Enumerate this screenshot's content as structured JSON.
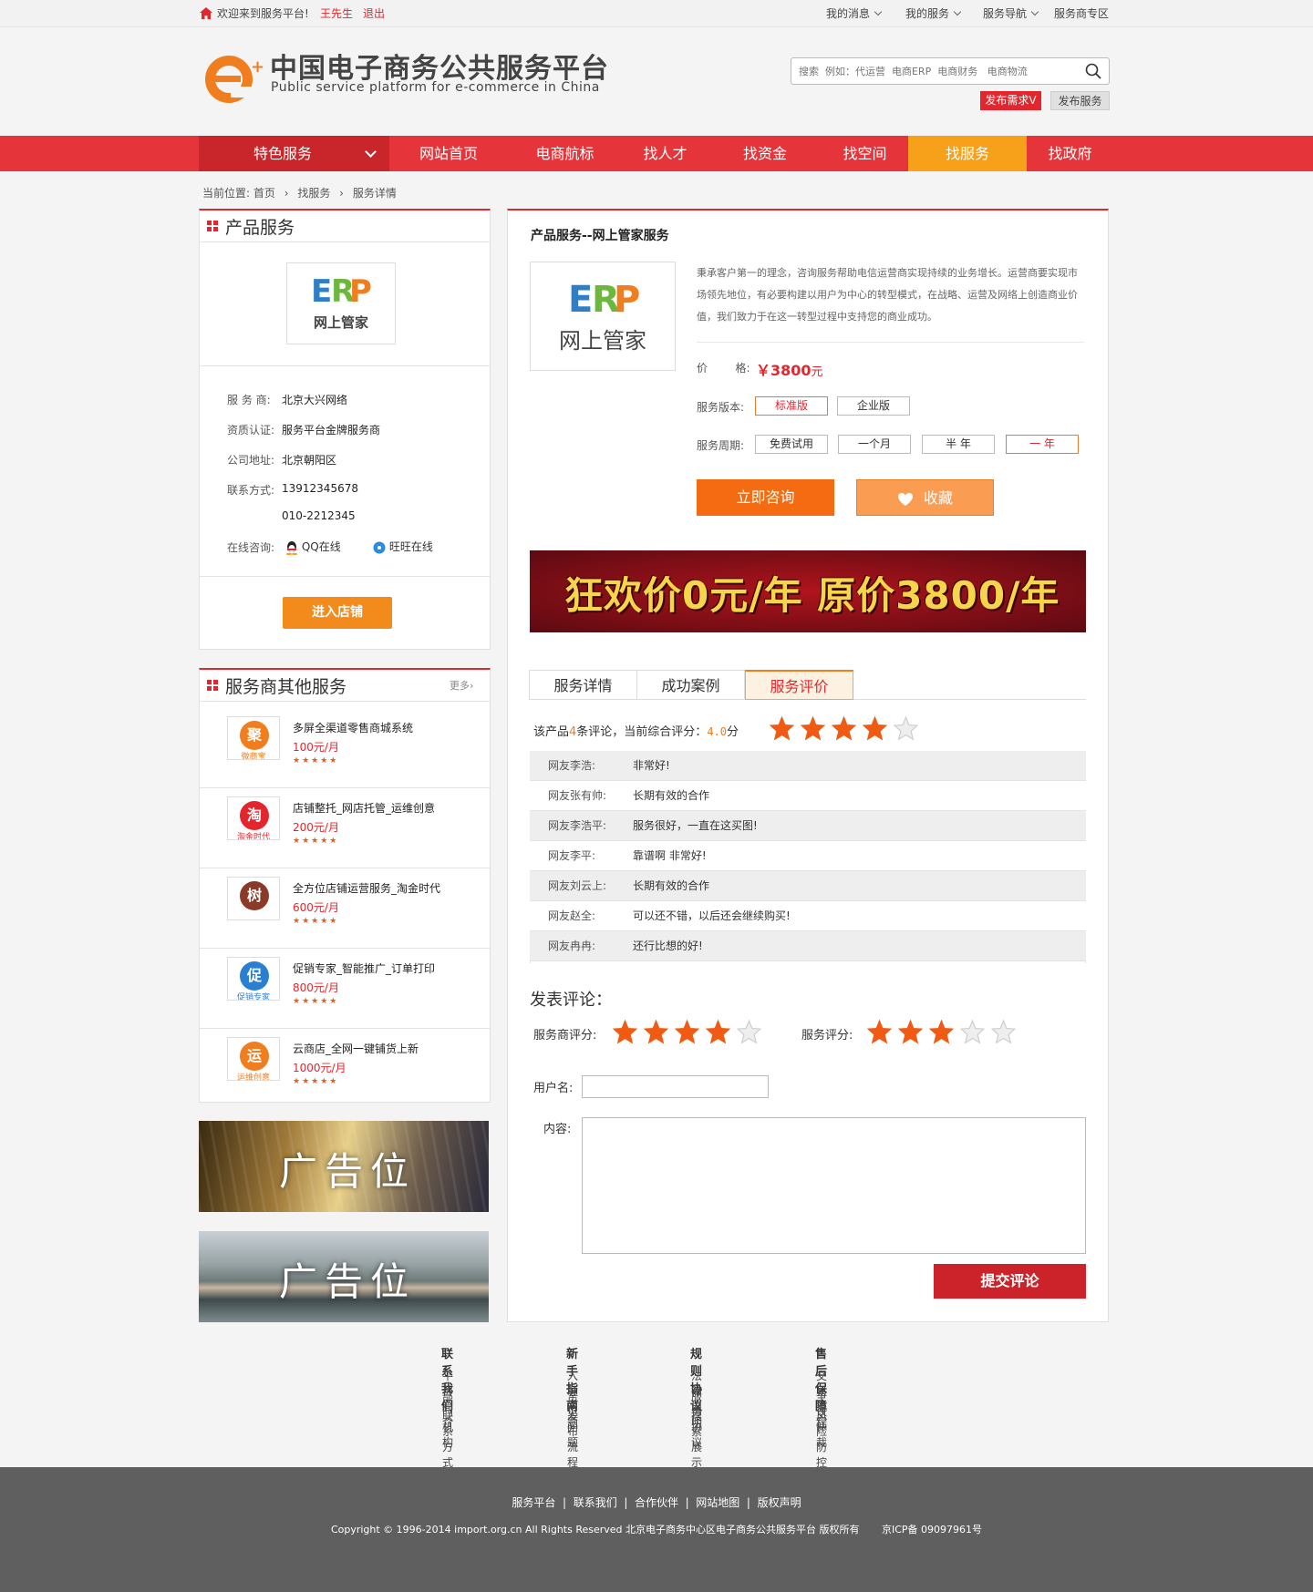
{
  "topbar": {
    "welcome": "欢迎来到服务平台!",
    "user": "王先生",
    "logout": "退出",
    "links": [
      "我的消息",
      "我的服务",
      "服务导航",
      "服务商专区"
    ]
  },
  "header": {
    "title_cn": "中国电子商务公共服务平台",
    "title_en": "Public service platform for e-commerce in China",
    "search_placeholder": "搜索  例如：代运营  电商ERP  电商财务   电商物流",
    "publish_demand": "发布需求V",
    "publish_service": "发布服务"
  },
  "nav": {
    "featured": "特色服务",
    "items": [
      "网站首页",
      "电商航标",
      "找人才",
      "找资金",
      "找空间",
      "找服务",
      "找政府"
    ],
    "active": "找服务"
  },
  "breadcrumb": [
    "当前位置: 首页",
    "找服务",
    "服务详情"
  ],
  "left_product": {
    "title": "产品服务",
    "logo_text": "网上管家",
    "fields": [
      {
        "label": "服 务 商:",
        "value": "北京大兴网络"
      },
      {
        "label": "资质认证:",
        "value": "服务平台金牌服务商"
      },
      {
        "label": "公司地址:",
        "value": "北京朝阳区"
      },
      {
        "label": "联系方式:",
        "value": "13912345678"
      },
      {
        "label": "",
        "value": "010-2212345"
      }
    ],
    "online_label": "在线咨询:",
    "qq": "QQ在线",
    "wangwang": "旺旺在线",
    "enter_store": "进入店铺"
  },
  "left_other": {
    "title": "服务商其他服务",
    "more": "更多",
    "items": [
      {
        "name": "多屏全渠道零售商城系统",
        "price": "100元/月",
        "logo": "聚",
        "logo_sub": "微商宝"
      },
      {
        "name": "店铺整托_网店托管_运维创意",
        "price": "200元/月",
        "logo": "淘",
        "logo_sub": "淘金时代"
      },
      {
        "name": "全方位店铺运营服务_淘金时代",
        "price": "600元/月",
        "logo": "树",
        "logo_sub": ""
      },
      {
        "name": "促销专家_智能推广_订单打印",
        "price": "800元/月",
        "logo": "促",
        "logo_sub": "促销专家"
      },
      {
        "name": "云商店_全网一键铺货上新",
        "price": "1000元/月",
        "logo": "运",
        "logo_sub": "运维创意"
      }
    ],
    "stars": "★★★★★"
  },
  "ads": {
    "ad1": "广告位",
    "ad2": "广告位"
  },
  "main": {
    "title": "产品服务--网上管家服务",
    "logo_text": "网上管家",
    "description": "秉承客户第一的理念，咨询服务帮助电信运营商实现持续的业务增长。运营商要实现市场领先地位，有必要构建以用户为中心的转型模式，在战略、运营及网络上创造商业价值，我们致力于在这一转型过程中支持您的商业成功。",
    "price_label": "价        格:",
    "price": "￥3800",
    "price_unit": "元",
    "version_label": "服务版本:",
    "versions": [
      "标准版",
      "企业版"
    ],
    "period_label": "服务周期:",
    "periods": [
      "免费试用",
      "一个月",
      "半 年",
      "一 年"
    ],
    "consult": "立即咨询",
    "favorite": "收藏",
    "banner_text": "狂欢价0元/年  原价3800/年",
    "tabs": [
      "服务详情",
      "成功案例",
      "服务评价"
    ],
    "active_tab": "服务评价",
    "rating_prefix": "该产品",
    "rating_count": "4",
    "rating_mid": "条评论，当前综合评分：",
    "rating_score": "4.0",
    "rating_suffix": "分",
    "rating_value": 4,
    "reviews": [
      {
        "name": "网友李浩:",
        "comment": "非常好!"
      },
      {
        "name": "网友张有帅:",
        "comment": "长期有效的合作"
      },
      {
        "name": "网友李浩平:",
        "comment": "服务很好，一直在这买图!"
      },
      {
        "name": "网友李平:",
        "comment": "靠谱啊 非常好!"
      },
      {
        "name": "网友刘云上:",
        "comment": "长期有效的合作"
      },
      {
        "name": "网友赵全:",
        "comment": "可以还不错，以后还会继续购买!"
      },
      {
        "name": "网友冉冉:",
        "comment": "还行比想的好!"
      }
    ],
    "post_title": "发表评论：",
    "provider_rating_label": "服务商评分:",
    "provider_rating": 4,
    "service_rating_label": "服务评分:",
    "service_rating": 3,
    "username_label": "用户名:",
    "content_label": "内容:",
    "submit": "提交评论"
  },
  "footer": {
    "columns": [
      {
        "title": "联系我们",
        "links": [
          "平台简介",
          "部门机构",
          "联系方式"
        ]
      },
      {
        "title": "新手指南",
        "links": [
          "入驻问题",
          "常见问题",
          "发布流程"
        ]
      },
      {
        "title": "规则协议",
        "links": [
          "法律申明",
          "服务协议",
          "搜索展示"
        ]
      },
      {
        "title": "售后保障",
        "links": [
          "交易流程",
          "争议仲裁",
          "风险防控"
        ]
      }
    ],
    "bottom_links": "服务平台  |  联系我们  |  合作伙伴  |  网站地图  |  版权声明",
    "copyright": "Copyright © 1996-2014 import.org.cn All Rights Reserved 北京电子商务中心区电子商务公共服务平台 版权所有       京ICP备 09097961号"
  },
  "colors": {
    "accent": "#e3262d",
    "nav": "#e5353a",
    "orange": "#f07d1e",
    "star": "#f05a13"
  }
}
